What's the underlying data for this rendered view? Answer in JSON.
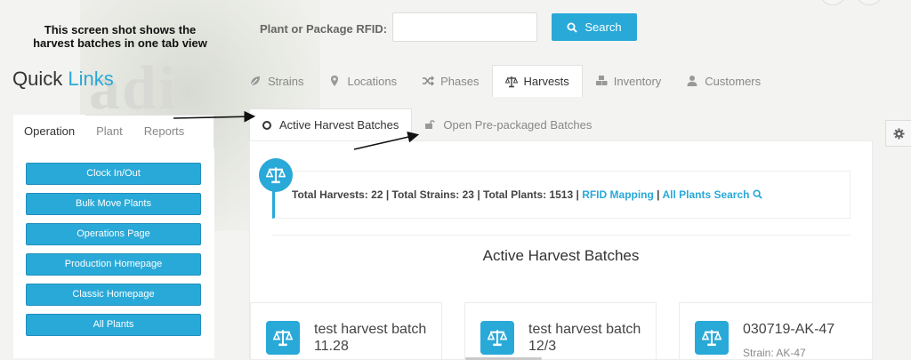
{
  "annotation": "This screen shot shows the harvest batches in one tab view",
  "rfid": {
    "label": "Plant or Package RFID:",
    "value": "",
    "search_label": "Search"
  },
  "quick_links": {
    "title_plain": "Quick ",
    "title_accent": "Links",
    "tabs": [
      {
        "label": "Operation",
        "active": true
      },
      {
        "label": "Plant",
        "active": false
      },
      {
        "label": "Reports",
        "active": false
      }
    ],
    "buttons": [
      "Clock In/Out",
      "Bulk Move Plants",
      "Operations Page",
      "Production Homepage",
      "Classic Homepage",
      "All Plants"
    ]
  },
  "main_tabs": [
    {
      "label": "Strains",
      "icon": "leaf-icon",
      "active": false
    },
    {
      "label": "Locations",
      "icon": "map-marker-icon",
      "active": false
    },
    {
      "label": "Phases",
      "icon": "shuffle-icon",
      "active": false
    },
    {
      "label": "Harvests",
      "icon": "balance-scale-icon",
      "active": true
    },
    {
      "label": "Inventory",
      "icon": "cubes-icon",
      "active": false
    },
    {
      "label": "Customers",
      "icon": "user-icon",
      "active": false
    }
  ],
  "sub_tabs": [
    {
      "label": "Active Harvest Batches",
      "icon": "circle-o-icon",
      "active": true
    },
    {
      "label": "Open Pre-packaged Batches",
      "icon": "unlock-icon",
      "active": false
    }
  ],
  "stats": {
    "text": "Total Harvests: 22 | Total Strains: 23 | Total Plants: 1513 | ",
    "rfid_link": "RFID Mapping",
    "separator": " | ",
    "all_plants_link": "All Plants Search"
  },
  "section_title": "Active Harvest Batches",
  "cards": [
    {
      "title": "test harvest batch 11.28",
      "subtitle": ""
    },
    {
      "title": "test harvest batch 12/3",
      "subtitle": ""
    },
    {
      "title": "030719-AK-47",
      "subtitle": "Strain: AK-47"
    }
  ],
  "colors": {
    "accent": "#29a9d8",
    "arrow": "#111111"
  }
}
